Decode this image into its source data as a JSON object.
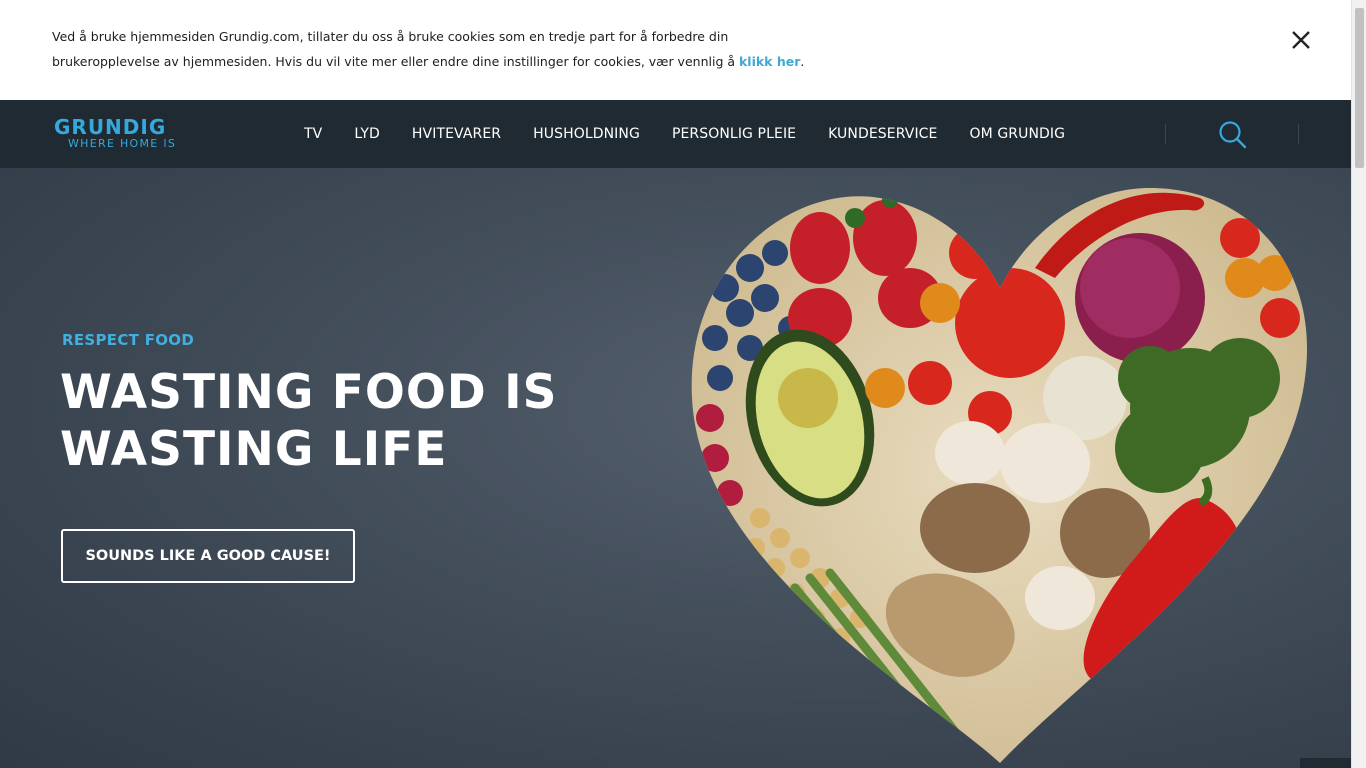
{
  "cookie_banner": {
    "line1": "Ved å bruke hjemmesiden Grundig.com, tillater du oss å bruke cookies som en tredje part for å forbedre din",
    "line2": "brukeropplevelse av hjemmesiden. Hvis du vil vite mer eller endre dine instillinger for cookies, vær vennlig å ",
    "link_text": "klikk her",
    "tail": ".",
    "close_icon": "close-icon"
  },
  "header": {
    "logo_main": "GRUNDIG",
    "logo_tagline": "WHERE HOME IS",
    "menu": [
      {
        "label": "TV"
      },
      {
        "label": "LYD"
      },
      {
        "label": "HVITEVARER"
      },
      {
        "label": "HUSHOLDNING"
      },
      {
        "label": "PERSONLIG PLEIE"
      },
      {
        "label": "KUNDESERVICE"
      },
      {
        "label": "OM GRUNDIG"
      }
    ],
    "search_icon": "search-icon"
  },
  "hero": {
    "eyebrow": "RESPECT FOOD",
    "headline_line1": "WASTING FOOD IS",
    "headline_line2": "WASTING LIFE",
    "cta_label": "SOUNDS LIKE A GOOD CAUSE!",
    "image": "heart-of-vegetables-image"
  },
  "colors": {
    "accent": "#35a8dc",
    "nav_bg": "#1f2a33",
    "hero_bg": "#46515e",
    "text_light": "#ffffff"
  }
}
